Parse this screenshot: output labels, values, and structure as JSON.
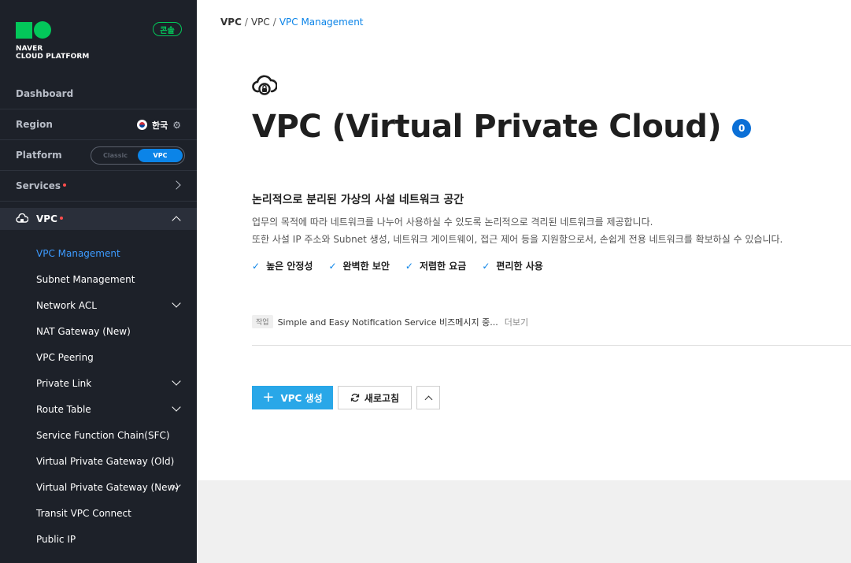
{
  "brand": {
    "line1": "NAVER",
    "line2": "CLOUD PLATFORM",
    "console_label": "콘솔",
    "color": "#03c75a"
  },
  "sidebar": {
    "dashboard": "Dashboard",
    "region": {
      "label": "Region",
      "value": "한국"
    },
    "platform": {
      "label": "Platform",
      "options": [
        "Classic",
        "VPC"
      ],
      "selected": "VPC"
    },
    "services": {
      "label": "Services"
    },
    "vpc_section": {
      "label": "VPC"
    },
    "items": [
      {
        "label": "VPC Management",
        "active": true,
        "expandable": false
      },
      {
        "label": "Subnet Management",
        "expandable": false
      },
      {
        "label": "Network ACL",
        "expandable": true
      },
      {
        "label": "NAT Gateway (New)",
        "expandable": false
      },
      {
        "label": "VPC Peering",
        "expandable": false
      },
      {
        "label": "Private Link",
        "expandable": true
      },
      {
        "label": "Route Table",
        "expandable": true
      },
      {
        "label": "Service Function Chain(SFC)",
        "expandable": false
      },
      {
        "label": "Virtual Private Gateway (Old)",
        "expandable": false
      },
      {
        "label": "Virtual Private Gateway (New)",
        "expandable": true
      },
      {
        "label": "Transit VPC Connect",
        "expandable": false
      },
      {
        "label": "Public IP",
        "expandable": false
      }
    ]
  },
  "breadcrumb": [
    "VPC",
    "VPC",
    "VPC Management"
  ],
  "main": {
    "title": "VPC (Virtual Private Cloud)",
    "count": "0",
    "subheading": "논리적으로 분리된 가상의 사설 네트워크 공간",
    "desc_line1": "업무의 목적에 따라 네트워크를 나누어 사용하실 수 있도록 논리적으로 격리된 네트워크를 제공합니다.",
    "desc_line2": "또한 사설 IP 주소와 Subnet 생성, 네트워크 게이트웨이, 접근 제어 등을 지원함으로서, 손쉽게 전용 네트워크를 확보하실 수 있습니다.",
    "features": [
      "높은 안정성",
      "완벽한 보안",
      "저렴한 요금",
      "편리한 사용"
    ],
    "notice": {
      "tag": "작업",
      "text": "Simple and Easy Notification Service 비즈메시지 중...",
      "more": "더보기"
    },
    "buttons": {
      "create": "VPC 생성",
      "refresh": "새로고침"
    }
  },
  "colors": {
    "accent": "#0b84e8",
    "sidebar_bg": "#1d2129",
    "create_button": "#29a7e8"
  }
}
